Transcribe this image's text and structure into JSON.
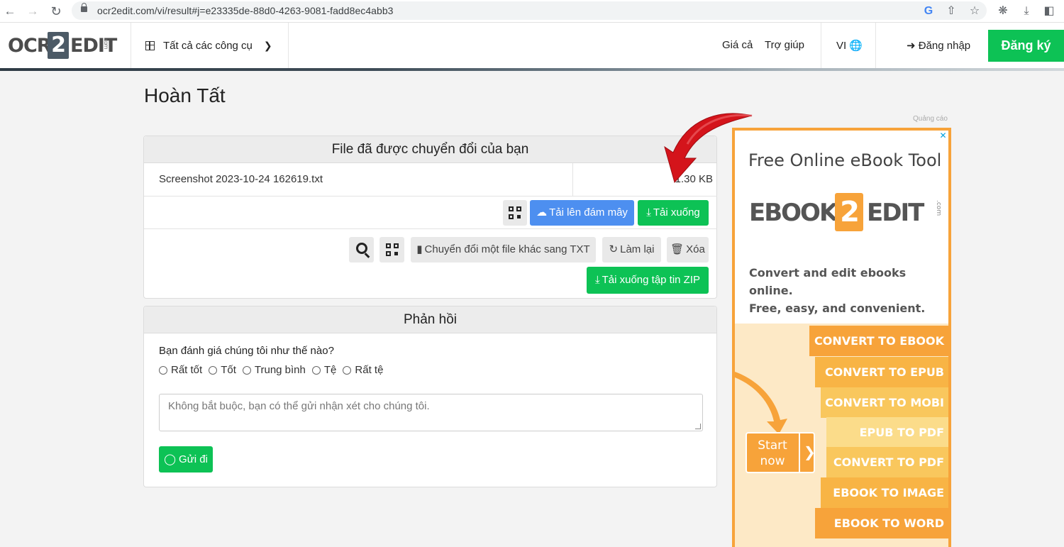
{
  "browser": {
    "url": "ocr2edit.com/vi/result#j=e23335de-88d0-4263-9081-fadd8ec4abb3"
  },
  "header": {
    "logo_left": "OCR",
    "logo_mid": "2",
    "logo_right": "EDIT",
    "logo_suffix": ".com",
    "tools_label": "Tất cả các công cụ",
    "pricing": "Giá cả",
    "help": "Trợ giúp",
    "language": "VI",
    "login": "Đăng nhập",
    "signup": "Đăng ký"
  },
  "page": {
    "title": "Hoàn Tất"
  },
  "result_card": {
    "heading": "File đã được chuyển đổi của bạn",
    "file_name": "Screenshot 2023-10-24 162619.txt",
    "file_size": "1.30 KB",
    "upload_cloud": "Tải lên đám mây",
    "download": "Tải xuống",
    "convert_another": "Chuyển đổi một file khác sang TXT",
    "redo": "Làm lại",
    "delete": "Xóa",
    "download_zip": "Tải xuống tập tin ZIP"
  },
  "feedback": {
    "heading": "Phản hồi",
    "question": "Bạn đánh giá chúng tôi như thế nào?",
    "options": [
      "Rất tốt",
      "Tốt",
      "Trung bình",
      "Tệ",
      "Rất tệ"
    ],
    "placeholder": "Không bắt buộc, bạn có thể gửi nhận xét cho chúng tôi.",
    "send": "Gửi đi"
  },
  "ad": {
    "label": "Quảng cáo",
    "title": "Free Online eBook Tool",
    "logo_left": "EBOOK",
    "logo_mid": "2",
    "logo_right": "EDIT",
    "logo_suffix": ".com",
    "desc_line1": "Convert and edit ebooks online.",
    "desc_line2": "Free, easy, and convenient.",
    "items": [
      "CONVERT TO EBOOK",
      "CONVERT TO EPUB",
      "CONVERT TO MOBI",
      "EPUB TO PDF",
      "CONVERT TO PDF",
      "EBOOK TO IMAGE",
      "EBOOK TO WORD"
    ],
    "start_line1": "Start",
    "start_line2": "now"
  },
  "colors": {
    "green": "#0dc255",
    "blue": "#4d8ff0",
    "ad_orange": "#f7a33a",
    "arrow_red": "#d4141b"
  }
}
